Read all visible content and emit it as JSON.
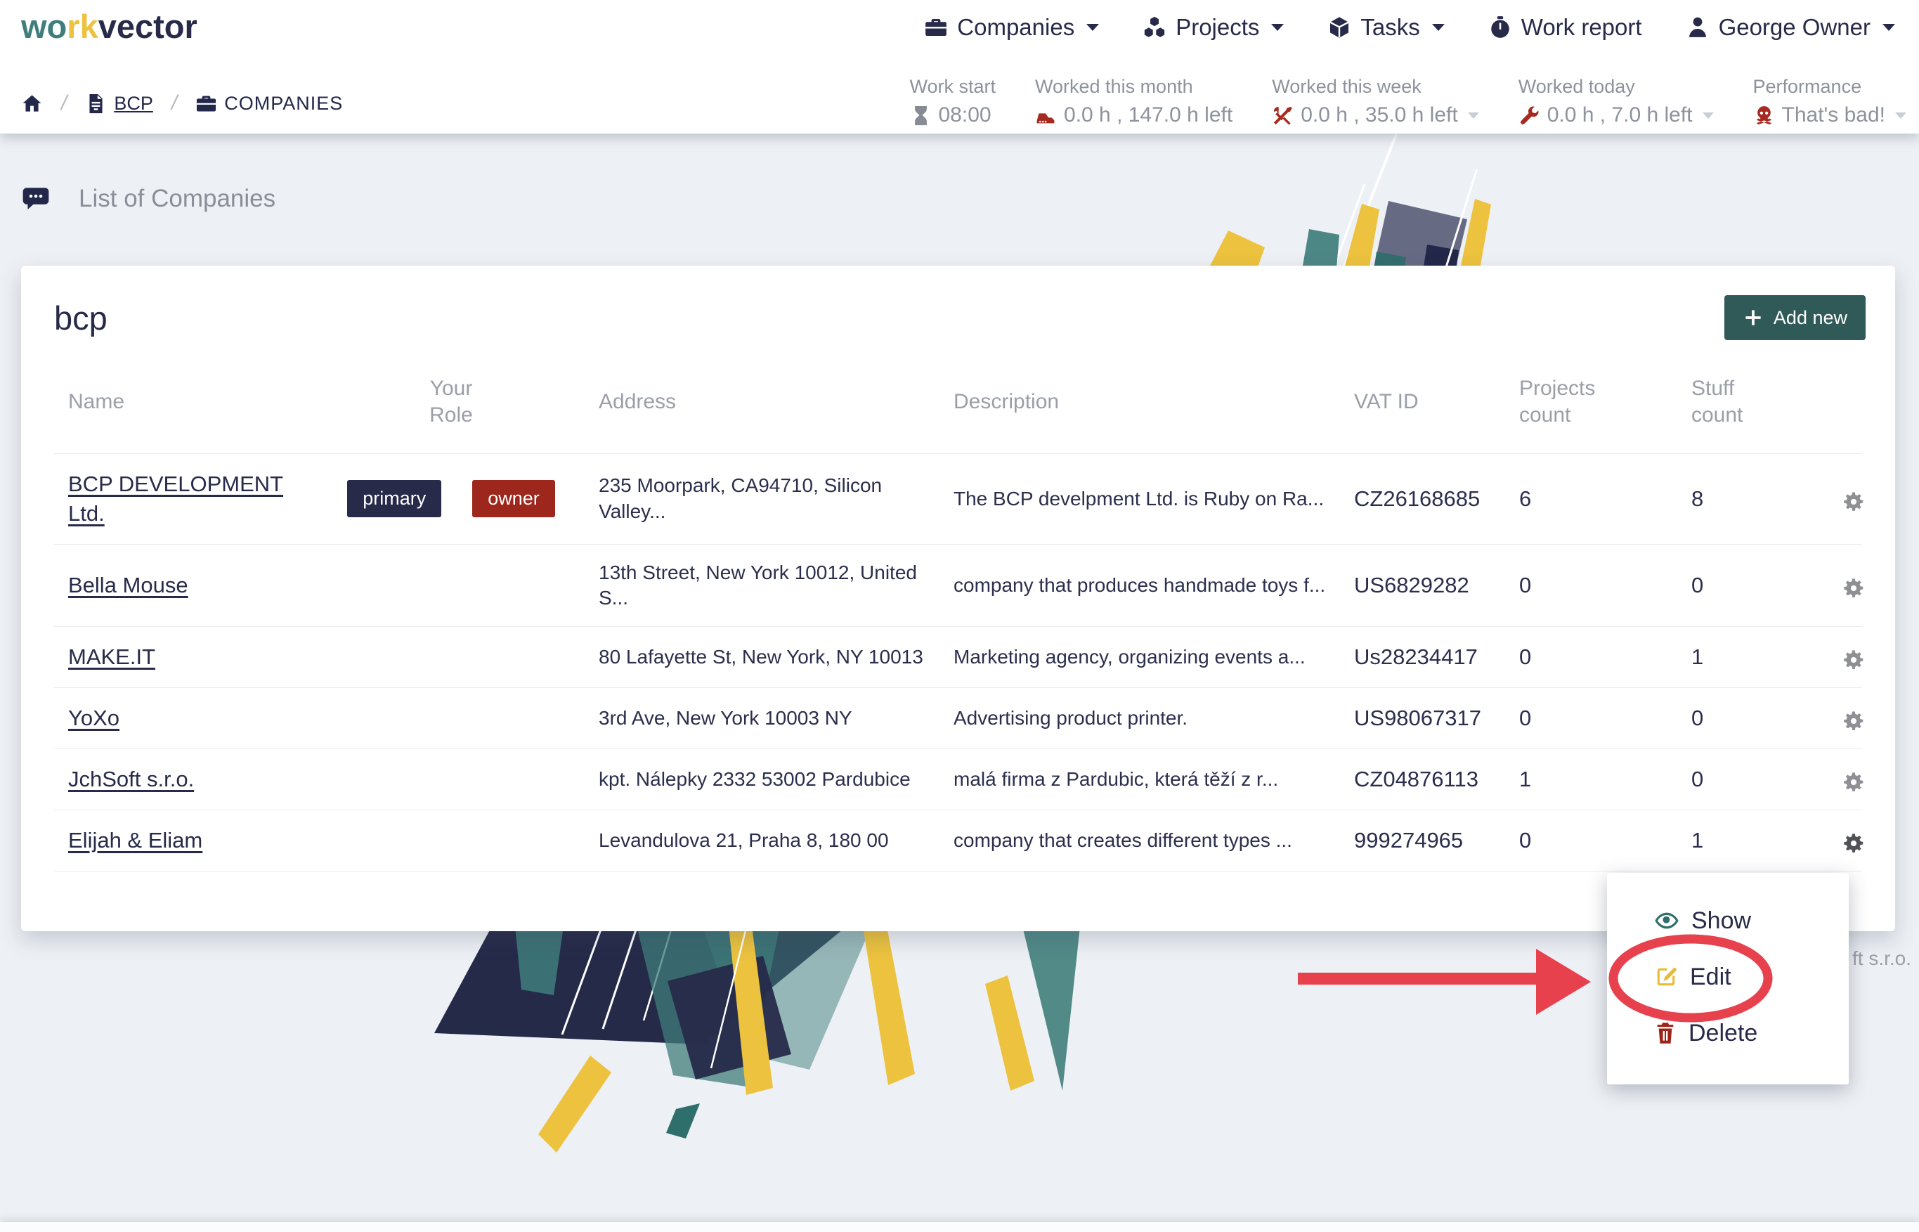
{
  "brand": {
    "part1": "wo",
    "part2": "rk",
    "part3": "vector"
  },
  "nav": {
    "companies": "Companies",
    "projects": "Projects",
    "tasks": "Tasks",
    "work_report": "Work report",
    "user": "George Owner",
    "icons": [
      "briefcase-icon",
      "cubes-icon",
      "cube-icon",
      "stopwatch-icon",
      "user-icon"
    ]
  },
  "breadcrumb": {
    "home_icon": "home-icon",
    "bcp": "BCP",
    "companies": "COMPANIES"
  },
  "stats": [
    {
      "label": "Work start",
      "value": "08:00",
      "icon": "hourglass-icon"
    },
    {
      "label": "Worked this month",
      "value": "0.0 h , 147.0 h left",
      "icon": "truck-icon"
    },
    {
      "label": "Worked this week",
      "value": "0.0 h , 35.0 h left",
      "icon": "tools-icon"
    },
    {
      "label": "Worked today",
      "value": "0.0 h , 7.0 h left",
      "icon": "wrench-icon"
    },
    {
      "label": "Performance",
      "value": "That's bad!",
      "icon": "skull-icon"
    }
  ],
  "page": {
    "section_title": "List of Companies",
    "card_title": "bcp",
    "add_button_label": "Add new"
  },
  "table": {
    "headers": {
      "name": "Name",
      "role": "Your Role",
      "address": "Address",
      "description": "Description",
      "vat": "VAT ID",
      "projects": "Projects count",
      "stuff": "Stuff count"
    },
    "rows": [
      {
        "name": "BCP DEVELOPMENT Ltd.",
        "badges": [
          "primary",
          "owner"
        ],
        "address": "235 Moorpark, CA94710, Silicon Valley...",
        "description": "The BCP develpment Ltd. is Ruby on Ra...",
        "vat": "CZ26168685",
        "projects": "6",
        "stuff": "8"
      },
      {
        "name": "Bella Mouse",
        "address": "13th Street, New York 10012, United S...",
        "description": "company that produces handmade toys f...",
        "vat": "US6829282",
        "projects": "0",
        "stuff": "0"
      },
      {
        "name": "MAKE.IT",
        "address": "80 Lafayette St, New York, NY 10013",
        "description": "Marketing agency, organizing events a...",
        "vat": "Us28234417",
        "projects": "0",
        "stuff": "1"
      },
      {
        "name": "YoXo",
        "address": "3rd Ave, New York 10003 NY",
        "description": "Advertising product printer.",
        "vat": "US98067317",
        "projects": "0",
        "stuff": "0"
      },
      {
        "name": "JchSoft s.r.o.",
        "address": "kpt. Nálepky 2332 53002 Pardubice",
        "description": "malá firma z Pardubic, která těží z r...",
        "vat": "CZ04876113",
        "projects": "1",
        "stuff": "0"
      },
      {
        "name": "Elijah & Eliam",
        "address": "Levandulova 21, Praha 8, 180 00",
        "description": "company that creates different types ...",
        "vat": "999274965",
        "projects": "0",
        "stuff": "1"
      }
    ]
  },
  "row_badges": {
    "primary": "primary",
    "owner": "owner"
  },
  "context_menu": {
    "show": "Show",
    "edit": "Edit",
    "delete": "Delete",
    "icons": [
      "eye-icon",
      "edit-icon",
      "trash-icon"
    ]
  },
  "background_text": "ft s.r.o.",
  "colors": {
    "navy": "#272b49",
    "teal": "#3f7e7b",
    "yellow": "#ecc23e",
    "dark_red": "#9d261d",
    "status_red_icon": "#a62a1f",
    "annotation_red": "#e8414e",
    "gray_text": "#8d929c",
    "page_bg": "#edf0f4",
    "button_bg": "#2f5a57"
  }
}
